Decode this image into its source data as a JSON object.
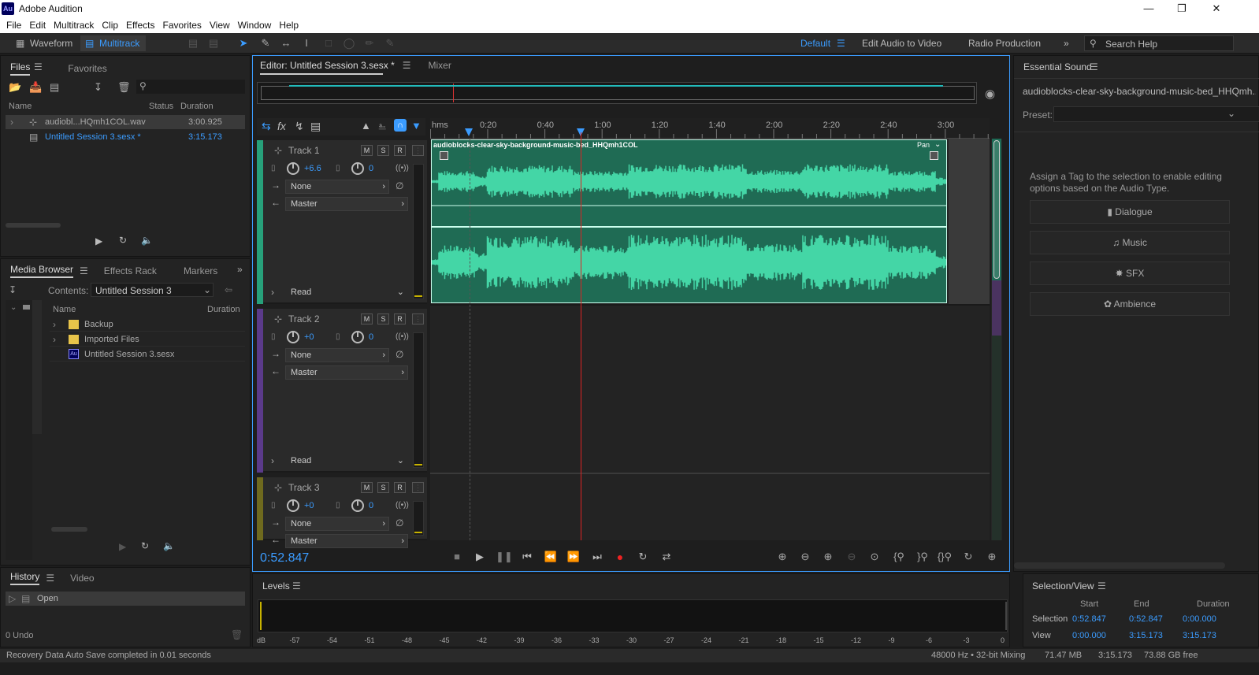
{
  "app": {
    "title": "Adobe Audition",
    "logo": "Au"
  },
  "menu": [
    "File",
    "Edit",
    "Multitrack",
    "Clip",
    "Effects",
    "Favorites",
    "View",
    "Window",
    "Help"
  ],
  "toolbar": {
    "waveform": "Waveform",
    "multitrack": "Multitrack",
    "workspaces": [
      "Default",
      "Edit Audio to Video",
      "Radio Production"
    ],
    "search_placeholder": "Search Help"
  },
  "files": {
    "tabs": [
      "Files",
      "Favorites"
    ],
    "columns": {
      "name": "Name",
      "status": "Status",
      "duration": "Duration"
    },
    "items": [
      {
        "name": "audiobl...HQmh1COL.wav",
        "duration": "3:00.925"
      },
      {
        "name": "Untitled Session 3.sesx *",
        "duration": "3:15.173"
      }
    ]
  },
  "media": {
    "tabs": [
      "Media Browser",
      "Effects Rack",
      "Markers"
    ],
    "contents_label": "Contents:",
    "contents_value": "Untitled Session 3",
    "columns": {
      "name": "Name",
      "duration": "Duration"
    },
    "items": [
      "Backup",
      "Imported Files",
      "Untitled Session 3.sesx"
    ]
  },
  "history": {
    "tabs": [
      "History",
      "Video"
    ],
    "item": "Open",
    "undo": "0 Undo"
  },
  "editor": {
    "tab": "Editor: Untitled Session 3.sesx *",
    "mixer": "Mixer",
    "ruler": [
      "hms",
      "0:20",
      "0:40",
      "1:00",
      "1:20",
      "1:40",
      "2:00",
      "2:20",
      "2:40",
      "3:00"
    ],
    "clip_name": "audioblocks-clear-sky-background-music-bed_HHQmh1COL",
    "pan": "Pan",
    "time": "0:52.847",
    "playhead_sec": 52.847,
    "total_sec": 195.173
  },
  "tracks": [
    {
      "name": "Track 1",
      "vol": "+6.6",
      "pan": "0",
      "input": "None",
      "output": "Master",
      "auto": "Read",
      "color": "#27a07a"
    },
    {
      "name": "Track 2",
      "vol": "+0",
      "pan": "0",
      "input": "None",
      "output": "Master",
      "auto": "Read",
      "color": "#5b3a8a"
    },
    {
      "name": "Track 3",
      "vol": "+0",
      "pan": "0",
      "input": "None",
      "output": "Master",
      "auto": "",
      "color": "#6f6a1e"
    }
  ],
  "msr": [
    "M",
    "S",
    "R"
  ],
  "levels": {
    "title": "Levels",
    "scale": [
      "dB",
      "-57",
      "-54",
      "-51",
      "-48",
      "-45",
      "-42",
      "-39",
      "-36",
      "-33",
      "-30",
      "-27",
      "-24",
      "-21",
      "-18",
      "-15",
      "-12",
      "-9",
      "-6",
      "-3",
      "0"
    ]
  },
  "essential": {
    "title": "Essential Sound",
    "file": "audioblocks-clear-sky-background-music-bed_HHQmh...",
    "preset_label": "Preset:",
    "hint": "Assign a Tag to the selection to enable editing options based on the Audio Type.",
    "types": [
      "Dialogue",
      "Music",
      "SFX",
      "Ambience"
    ]
  },
  "selview": {
    "title": "Selection/View",
    "cols": [
      "Start",
      "End",
      "Duration"
    ],
    "selection": {
      "label": "Selection",
      "start": "0:52.847",
      "end": "0:52.847",
      "dur": "0:00.000"
    },
    "view": {
      "label": "View",
      "start": "0:00.000",
      "end": "3:15.173",
      "dur": "3:15.173"
    }
  },
  "status": {
    "left": "Recovery Data Auto Save completed in 0.01 seconds",
    "rate": "48000 Hz • 32-bit Mixing",
    "mem": "71.47 MB",
    "dur": "3:15.173",
    "free": "73.88 GB free"
  }
}
